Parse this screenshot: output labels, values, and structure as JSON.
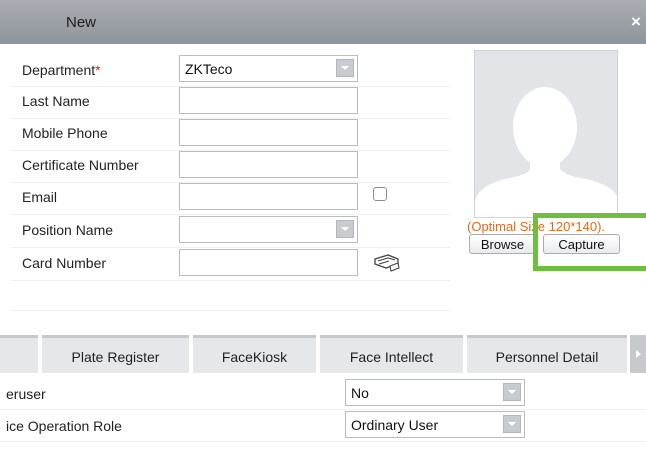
{
  "dialog": {
    "title": "New",
    "close_label": "×"
  },
  "form": {
    "department": {
      "label": "Department",
      "required_mark": "*",
      "value": "ZKTeco"
    },
    "last_name": {
      "label": "Last Name",
      "value": ""
    },
    "mobile_phone": {
      "label": "Mobile Phone",
      "value": ""
    },
    "certificate_number": {
      "label": "Certificate Number",
      "value": ""
    },
    "email": {
      "label": "Email",
      "value": ""
    },
    "position_name": {
      "label": "Position Name",
      "value": ""
    },
    "card_number": {
      "label": "Card Number",
      "value": ""
    }
  },
  "photo": {
    "hint": "(Optimal Size 120*140).",
    "browse_label": "Browse",
    "capture_label": "Capture"
  },
  "tabs": [
    {
      "label": "Plate Register"
    },
    {
      "label": "FaceKiosk"
    },
    {
      "label": "Face Intellect"
    },
    {
      "label": "Personnel Detail"
    }
  ],
  "details": {
    "superuser": {
      "label": "eruser",
      "value": "No"
    },
    "device_role": {
      "label": "ice Operation Role",
      "value": "Ordinary User"
    }
  },
  "colors": {
    "highlight": "#6dbf3d",
    "hint": "#e06a1a",
    "required": "#e02020"
  }
}
